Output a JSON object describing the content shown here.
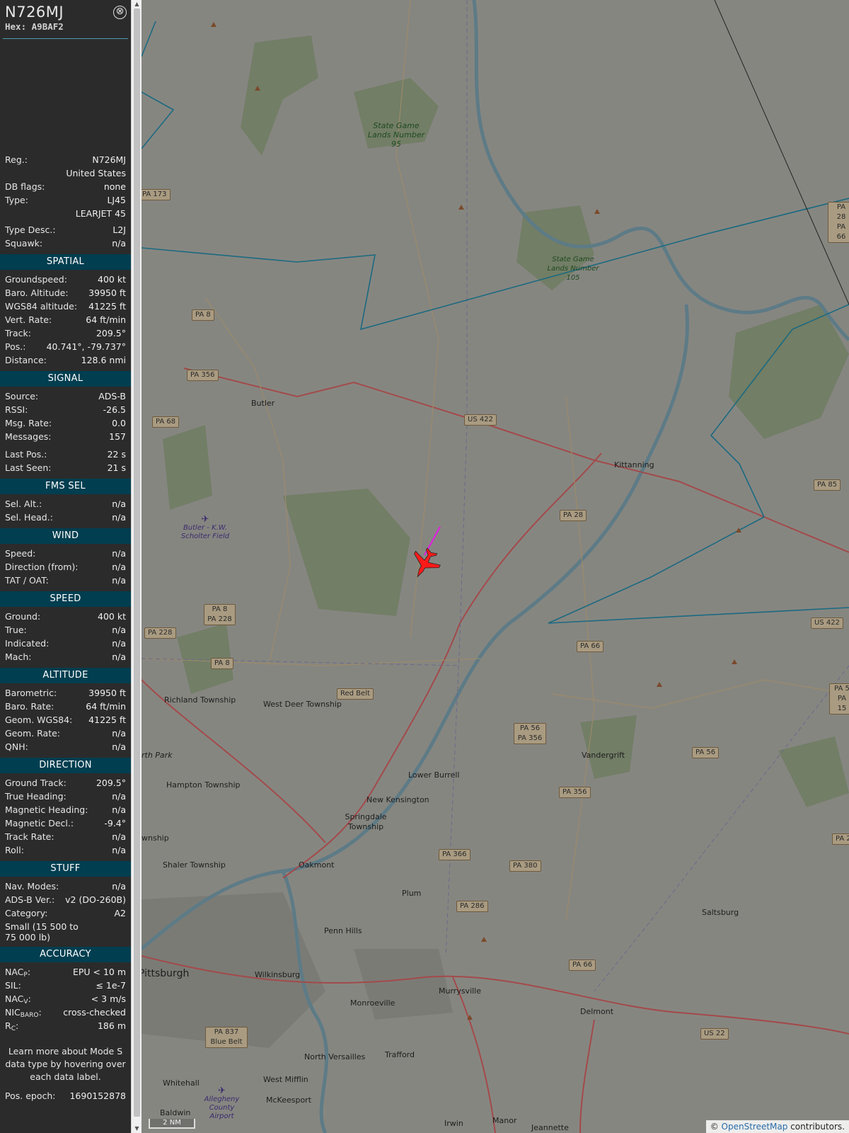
{
  "aircraft": {
    "callsign": "N726MJ",
    "hex_label": "Hex:",
    "hex": "A9BAF2",
    "close_symbol": "⊗"
  },
  "info": {
    "reg_label": "Reg.:",
    "reg": "N726MJ",
    "country": "United States",
    "dbflags_label": "DB flags:",
    "dbflags": "none",
    "type_label": "Type:",
    "type": "LJ45",
    "type_name": "LEARJET 45",
    "typedesc_label": "Type Desc.:",
    "typedesc": "L2J",
    "squawk_label": "Squawk:",
    "squawk": "n/a"
  },
  "spatial": {
    "title": "SPATIAL",
    "rows": [
      {
        "k": "Groundspeed:",
        "v": "400 kt"
      },
      {
        "k": "Baro. Altitude:",
        "v": "39950 ft"
      },
      {
        "k": "WGS84 altitude:",
        "v": "41225 ft"
      },
      {
        "k": "Vert. Rate:",
        "v": "64 ft/min"
      },
      {
        "k": "Track:",
        "v": "209.5°"
      },
      {
        "k": "Pos.:",
        "v": "40.741°, -79.737°"
      },
      {
        "k": "Distance:",
        "v": "128.6 nmi"
      }
    ]
  },
  "signal": {
    "title": "SIGNAL",
    "rows": [
      {
        "k": "Source:",
        "v": "ADS-B"
      },
      {
        "k": "RSSI:",
        "v": "-26.5"
      },
      {
        "k": "Msg. Rate:",
        "v": "0.0"
      },
      {
        "k": "Messages:",
        "v": "157"
      }
    ],
    "rows2": [
      {
        "k": "Last Pos.:",
        "v": "22 s"
      },
      {
        "k": "Last Seen:",
        "v": "21 s"
      }
    ]
  },
  "fms": {
    "title": "FMS SEL",
    "rows": [
      {
        "k": "Sel. Alt.:",
        "v": "n/a"
      },
      {
        "k": "Sel. Head.:",
        "v": "n/a"
      }
    ]
  },
  "wind": {
    "title": "WIND",
    "rows": [
      {
        "k": "Speed:",
        "v": "n/a"
      },
      {
        "k": "Direction (from):",
        "v": "n/a"
      },
      {
        "k": "TAT / OAT:",
        "v": "n/a"
      }
    ]
  },
  "speed": {
    "title": "SPEED",
    "rows": [
      {
        "k": "Ground:",
        "v": "400 kt"
      },
      {
        "k": "True:",
        "v": "n/a"
      },
      {
        "k": "Indicated:",
        "v": "n/a"
      },
      {
        "k": "Mach:",
        "v": "n/a"
      }
    ]
  },
  "altitude": {
    "title": "ALTITUDE",
    "rows": [
      {
        "k": "Barometric:",
        "v": "39950 ft"
      },
      {
        "k": "Baro. Rate:",
        "v": "64 ft/min"
      },
      {
        "k": "Geom. WGS84:",
        "v": "41225 ft"
      },
      {
        "k": "Geom. Rate:",
        "v": "n/a"
      },
      {
        "k": "QNH:",
        "v": "n/a"
      }
    ]
  },
  "direction": {
    "title": "DIRECTION",
    "rows": [
      {
        "k": "Ground Track:",
        "v": "209.5°"
      },
      {
        "k": "True Heading:",
        "v": "n/a"
      },
      {
        "k": "Magnetic Heading:",
        "v": "n/a"
      },
      {
        "k": "Magnetic Decl.:",
        "v": "-9.4°"
      },
      {
        "k": "Track Rate:",
        "v": "n/a"
      },
      {
        "k": "Roll:",
        "v": "n/a"
      }
    ]
  },
  "stuff": {
    "title": "STUFF",
    "navmodes_label": "Nav. Modes:",
    "navmodes": "n/a",
    "adsbver_label": "ADS-B Ver.:",
    "adsbver": "v2 (DO-260B)",
    "category_label": "Category:",
    "category": "A2",
    "category_desc": "Small (15 500 to 75 000 lb)"
  },
  "accuracy": {
    "title": "ACCURACY",
    "nacp_label": "NAC",
    "nacp_sub": "P",
    "nacp": "EPU < 10 m",
    "sil_label": "SIL:",
    "sil": "≤ 1e-7",
    "nacv_label": "NAC",
    "nacv_sub": "V",
    "nacv": "< 3 m/s",
    "nicbaro_label": "NIC",
    "nicbaro_sub": "BARO",
    "nicbaro": "cross-checked",
    "rc_label": "R",
    "rc_sub": "C",
    "rc": "186 m"
  },
  "note": "Learn more about Mode S data type by hovering over each data label.",
  "epoch_label": "Pos. epoch:",
  "epoch": "1690152878",
  "map": {
    "places": [
      "Butler",
      "Kittanning",
      "Richland Township",
      "West Deer Township",
      "Lower Burrell",
      "New Kensington",
      "Springdale Township",
      "Hampton Township",
      "Oakmont",
      "Shaler Township",
      "Plum",
      "Penn Hills",
      "Pittsburgh",
      "Wilkinsburg",
      "Monroeville",
      "Murrysville",
      "Delmont",
      "Vandergrift",
      "Saltsburg",
      "North Versailles",
      "Trafford",
      "West Mifflin",
      "McKeesport",
      "Whitehall",
      "Baldwin",
      "Irwin",
      "Manor",
      "Jeannette",
      "rth Park",
      "wnship"
    ],
    "roads": [
      "PA 173",
      "PA 8",
      "PA 356",
      "PA 68",
      "US 422",
      "PA 28",
      "PA 85",
      "PA 8 PA 228",
      "PA 228",
      "PA 8",
      "Red Belt",
      "PA 66",
      "US 422",
      "PA 56 PA 356",
      "PA 56",
      "PA 356",
      "PA 366",
      "PA 380",
      "PA 286",
      "PA 66",
      "PA 837 Blue Belt",
      "US 22",
      "PA 28 PA 66",
      "PA 5 PA 15",
      "PA 28"
    ],
    "parks": [
      "State Game Lands Number 95",
      "State Game Lands Number 105"
    ],
    "airports": [
      "Butler - K.W. Scholter Field",
      "Allegheny County Airport"
    ],
    "scale": "2 NM",
    "attribution_prefix": "© ",
    "attribution_link": "OpenStreetMap",
    "attribution_suffix": " contributors.",
    "aircraft_color": "#ff1a1a",
    "track_color": "#e619e6",
    "airspace_color": "#1b6a80"
  }
}
